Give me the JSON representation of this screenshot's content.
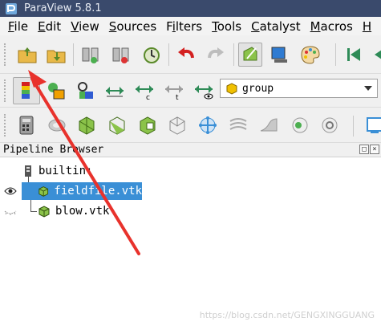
{
  "window": {
    "title": "ParaView 5.8.1"
  },
  "menu": {
    "items": [
      {
        "label": "File",
        "mnemonic": "F",
        "rest": "ile"
      },
      {
        "label": "Edit",
        "mnemonic": "E",
        "rest": "dit"
      },
      {
        "label": "View",
        "mnemonic": "V",
        "rest": "iew"
      },
      {
        "label": "Sources",
        "mnemonic": "S",
        "rest": "ources"
      },
      {
        "label": "Filters",
        "pre": "F",
        "mnemonic": "i",
        "rest": "lters"
      },
      {
        "label": "Tools",
        "mnemonic": "T",
        "rest": "ools"
      },
      {
        "label": "Catalyst",
        "mnemonic": "C",
        "rest": "atalyst"
      },
      {
        "label": "Macros",
        "mnemonic": "M",
        "rest": "acros"
      },
      {
        "label": "H",
        "mnemonic": "H",
        "rest": ""
      }
    ]
  },
  "toolbar2": {
    "selection_combo": {
      "value": "group"
    }
  },
  "pipeline_browser": {
    "title": "Pipeline Browser",
    "header_buttons": [
      "float",
      "close"
    ],
    "items": [
      {
        "label": "builtin:",
        "icon": "server-icon",
        "selected": false,
        "visible": null
      },
      {
        "label": "fieldfile.vtk",
        "icon": "cube-icon",
        "selected": true,
        "visible": true
      },
      {
        "label": "blow.vtk",
        "icon": "cube-icon",
        "selected": false,
        "visible": false
      }
    ]
  },
  "watermark": {
    "text": "https://blog.csdn.net/GENGXINGGUANG"
  },
  "colors": {
    "selection": "#3a8fd6",
    "annotation_arrow": "#e8322c",
    "titlebar": "#3a4a6c"
  }
}
